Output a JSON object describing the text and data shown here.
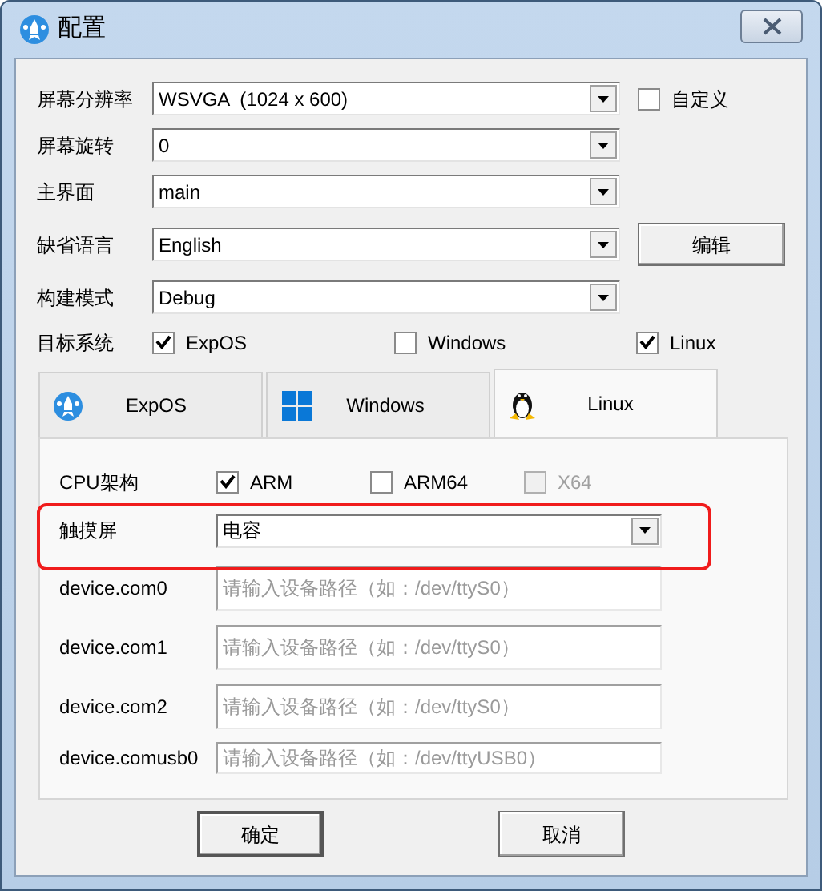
{
  "window": {
    "title": "配置"
  },
  "rows": [
    {
      "kind": "combo",
      "label": "屏幕分辨率",
      "value": "WSVGA  (1024 x 600)",
      "checkbox": {
        "label": "自定义",
        "checked": false
      }
    },
    {
      "kind": "combo",
      "label": "屏幕旋转",
      "value": "0"
    },
    {
      "kind": "combo",
      "label": "主界面",
      "value": "main"
    },
    {
      "kind": "combo",
      "label": "缺省语言",
      "value": "English",
      "button": "编辑"
    },
    {
      "kind": "combo",
      "label": "构建模式",
      "value": "Debug"
    },
    {
      "kind": "checks",
      "label": "目标系统",
      "options": [
        {
          "label": "ExpOS",
          "checked": true
        },
        {
          "label": "Windows",
          "checked": false
        },
        {
          "label": "Linux",
          "checked": true
        }
      ]
    }
  ],
  "tabs": [
    {
      "label": "ExpOS",
      "selected": false
    },
    {
      "label": "Windows",
      "selected": false
    },
    {
      "label": "Linux",
      "selected": true
    }
  ],
  "panel": {
    "cpu": {
      "label": "CPU架构",
      "options": [
        {
          "label": "ARM",
          "checked": true,
          "disabled": false
        },
        {
          "label": "ARM64",
          "checked": false,
          "disabled": false
        },
        {
          "label": "X64",
          "checked": false,
          "disabled": true
        }
      ]
    },
    "touch": {
      "label": "触摸屏",
      "value": "电容",
      "highlighted": true
    },
    "devices": [
      {
        "label": "device.com0",
        "placeholder": "请输入设备路径（如：/dev/ttyS0）"
      },
      {
        "label": "device.com1",
        "placeholder": "请输入设备路径（如：/dev/ttyS0）"
      },
      {
        "label": "device.com2",
        "placeholder": "请输入设备路径（如：/dev/ttyS0）"
      },
      {
        "label": "device.comusb0",
        "placeholder": "请输入设备路径（如：/dev/ttyUSB0）"
      }
    ]
  },
  "buttons": [
    {
      "label": "确定",
      "default": true
    },
    {
      "label": "取消",
      "default": false
    }
  ]
}
